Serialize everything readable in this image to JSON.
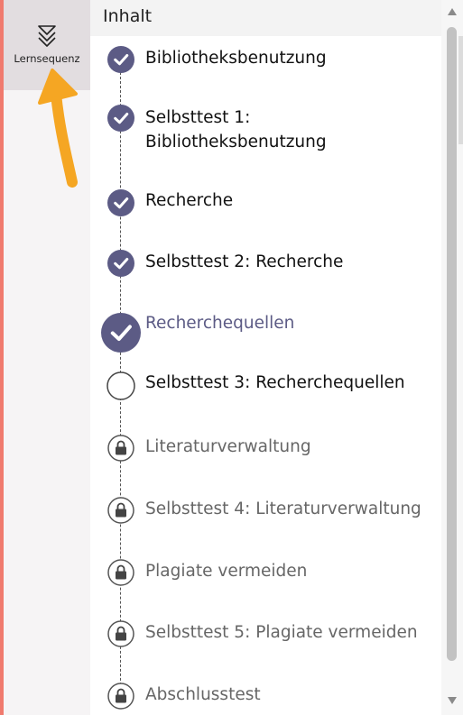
{
  "sidebar": {
    "tab": {
      "label": "Lernsequenz",
      "icon": "lernsequenz-icon"
    }
  },
  "annotation": {
    "icon": "pointer-arrow-icon",
    "color": "#f5a623"
  },
  "panel": {
    "title": "Inhalt"
  },
  "colors": {
    "accent": "#5c5b85",
    "strip": "#f07a6e"
  },
  "items": [
    {
      "label": "Bibliotheksbenutzung",
      "status": "completed"
    },
    {
      "label": "Selbsttest 1: Bibliotheksbenutzung",
      "status": "completed"
    },
    {
      "label": "Recherche",
      "status": "completed"
    },
    {
      "label": "Selbsttest 2: Recherche",
      "status": "completed"
    },
    {
      "label": "Recherchequellen",
      "status": "completed-current"
    },
    {
      "label": "Selbsttest 3: Recherchequellen",
      "status": "not-started"
    },
    {
      "label": "Literaturverwaltung",
      "status": "locked"
    },
    {
      "label": "Selbsttest 4: Literaturverwaltung",
      "status": "locked"
    },
    {
      "label": "Plagiate vermeiden",
      "status": "locked"
    },
    {
      "label": "Selbsttest 5: Plagiate vermeiden",
      "status": "locked"
    },
    {
      "label": "Abschlusstest",
      "status": "locked"
    }
  ]
}
